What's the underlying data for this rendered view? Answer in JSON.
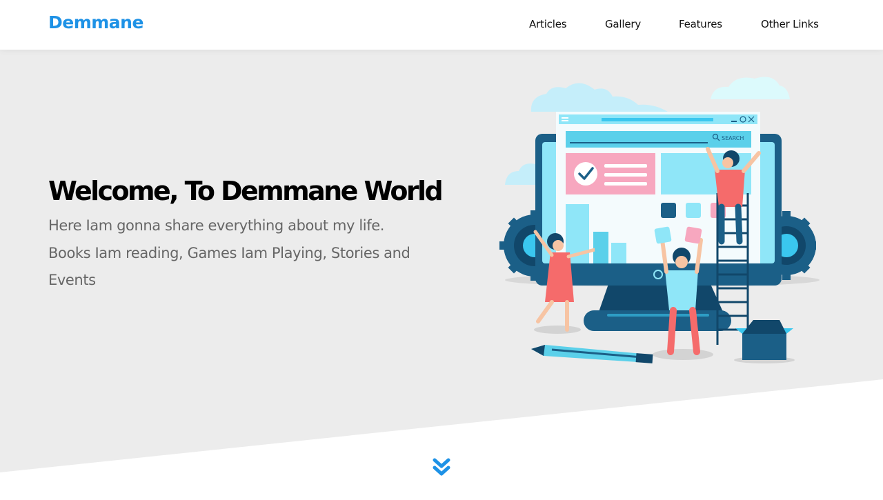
{
  "header": {
    "logo": "Demmane",
    "nav": [
      {
        "label": "Articles"
      },
      {
        "label": "Gallery"
      },
      {
        "label": "Features"
      },
      {
        "label": "Other Links"
      }
    ]
  },
  "hero": {
    "title": "Welcome, To Demmane World",
    "lines": [
      "Here Iam gonna share everything about my life.",
      "Books Iam reading, Games Iam Playing, Stories and",
      "Events"
    ],
    "illustration": {
      "search_label": "SEARCH"
    }
  },
  "icons": {
    "scroll": "double-chevron-down-icon"
  },
  "colors": {
    "brand": "#1e92e6",
    "hero_bg": "#ececec",
    "header_bg": "#ffffff",
    "text_dark": "#000000",
    "text_muted": "#666666"
  }
}
